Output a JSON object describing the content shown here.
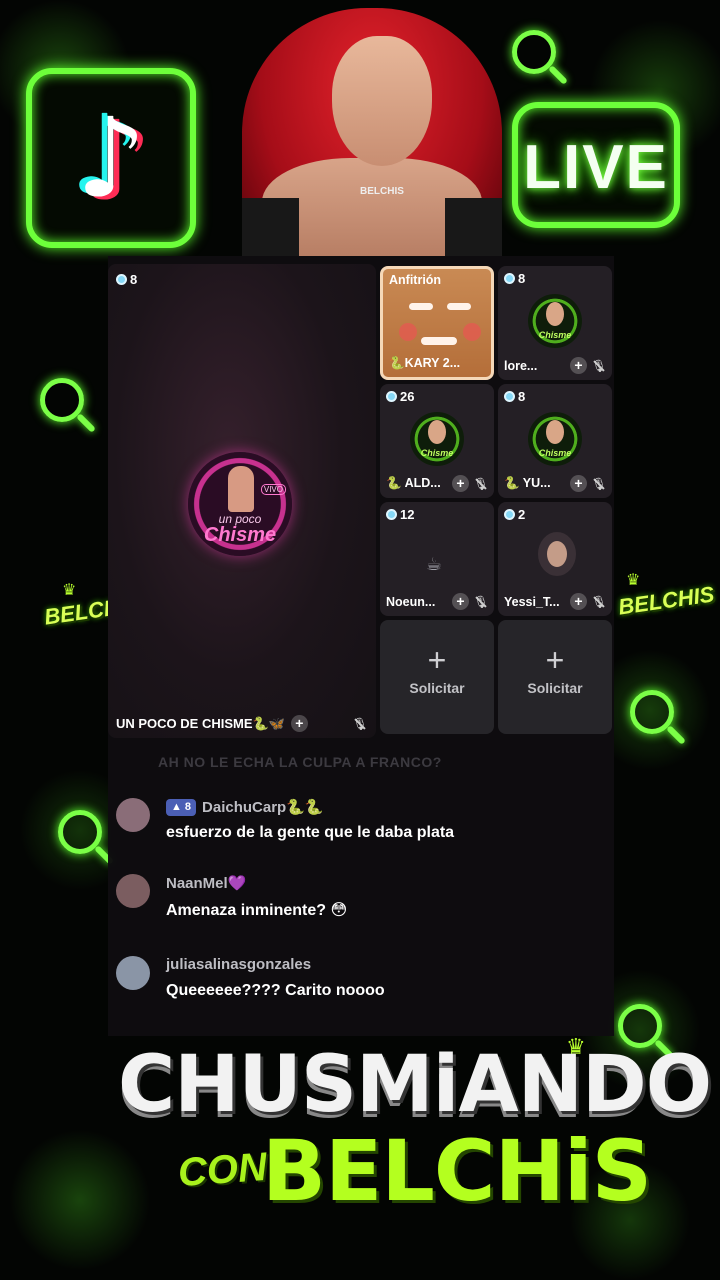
{
  "header": {
    "live_label": "LIVE"
  },
  "side_badges": {
    "left": "BELCHIS",
    "right": "BELCHIS"
  },
  "portrait": {
    "necklace": "BELCHIS"
  },
  "main_video": {
    "viewers": "8",
    "logo_small": "un poco",
    "logo_big": "Chisme",
    "logo_tag": "VIVO",
    "name": "UN POCO DE CHISME🐍🦋"
  },
  "guests": [
    {
      "label": "Anfitrión",
      "name": "🐍KARY 2...",
      "host": true
    },
    {
      "viewers": "8",
      "name": "lore..."
    },
    {
      "viewers": "26",
      "name": "🐍 ALD..."
    },
    {
      "viewers": "8",
      "name": "🐍 YU..."
    },
    {
      "viewers": "12",
      "name": "Noeun..."
    },
    {
      "viewers": "2",
      "name": "Yessi_T..."
    }
  ],
  "request": {
    "label": "Solicitar"
  },
  "faded_comment": "AH NO LE ECHA LA CULPA A FRANCO?",
  "chat": [
    {
      "user": "DaichuCarp🐍🐍",
      "level": "8",
      "message": "esfuerzo de la gente que le daba plata",
      "avatar_color": "#8a6d78"
    },
    {
      "user": "NaanMel💜",
      "message": "Amenaza inminente? 😳",
      "avatar_color": "#7b5d60"
    },
    {
      "user": "juliasalinasgonzales",
      "message": "Queeeeee???? Carito noooo",
      "avatar_color": "#8a95a6"
    }
  ],
  "title": {
    "line1": "CHUSMiANDO",
    "con": "CON",
    "line2": "BELCHiS"
  },
  "colors": {
    "neon_green": "#6dff3a",
    "tiktok_cyan": "#25f4ee",
    "tiktok_red": "#fe2c55"
  }
}
